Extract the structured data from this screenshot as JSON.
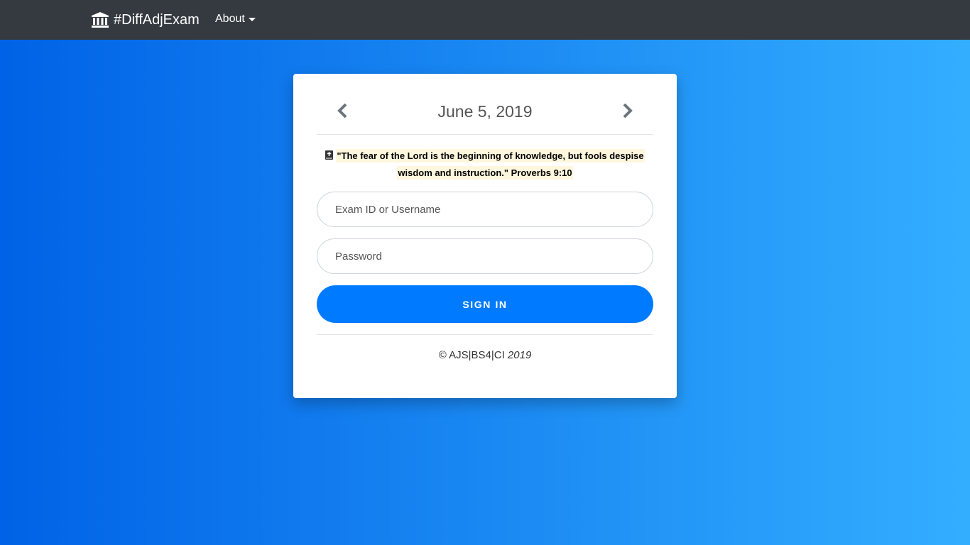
{
  "navbar": {
    "brand": "#DiffAdjExam",
    "brand_icon": "university-icon",
    "about_label": "About"
  },
  "card": {
    "date": "June 5, 2019",
    "prev_icon": "chevron-left-icon",
    "next_icon": "chevron-right-icon",
    "verse_icon": "bible-icon",
    "verse_line1": "\"The fear of the Lord is the beginning of knowledge, but fools despise",
    "verse_line2": "wisdom and instruction.\" Proverbs 9:10",
    "username_placeholder": "Exam ID or Username",
    "password_placeholder": "Password",
    "signin_label": "SIGN IN",
    "footer_copyright": "© AJS|BS4|CI",
    "footer_year": "2019"
  },
  "colors": {
    "navbar": "#343a40",
    "gradient_start": "#0062E6",
    "gradient_end": "#33AEFF",
    "button": "#007bff",
    "verse_highlight": "#fff7dd"
  }
}
